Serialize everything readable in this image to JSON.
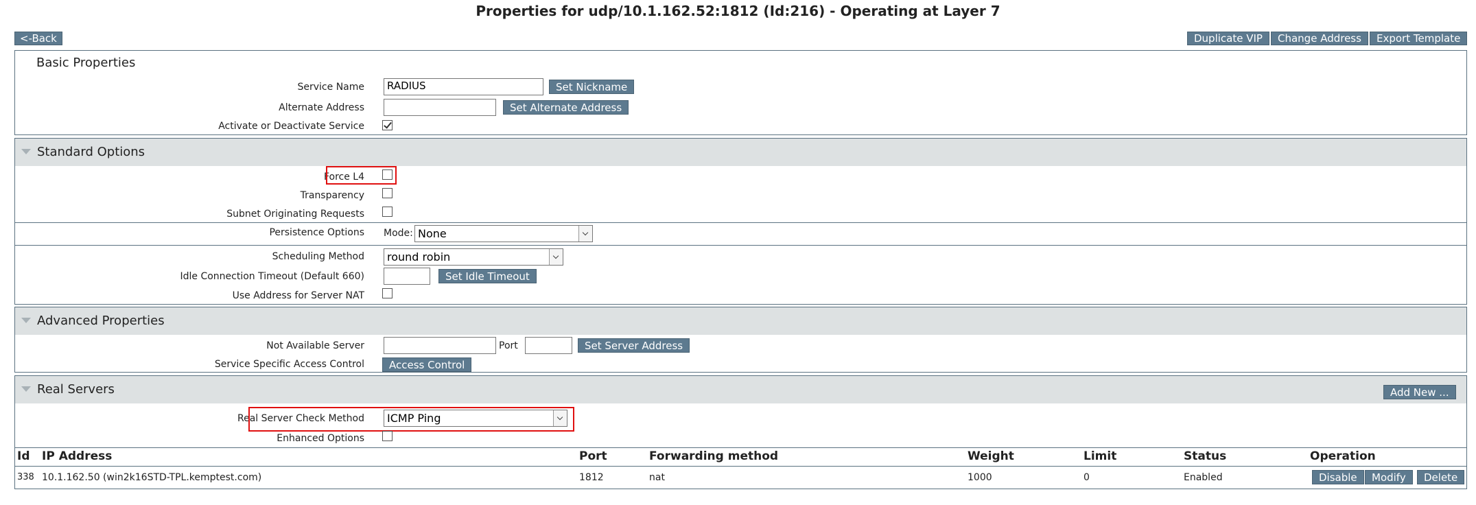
{
  "page": {
    "title": "Properties for udp/10.1.162.52:1812 (Id:216) - Operating at Layer 7"
  },
  "toolbar": {
    "back_label": "<-Back",
    "duplicate_label": "Duplicate VIP",
    "change_address_label": "Change Address",
    "export_label": "Export Template"
  },
  "basic": {
    "heading": "Basic Properties",
    "service_name_label": "Service Name",
    "service_name_value": "RADIUS",
    "set_nickname_label": "Set Nickname",
    "alt_address_label": "Alternate Address",
    "alt_address_value": "",
    "set_alt_address_label": "Set Alternate Address",
    "activate_label": "Activate or Deactivate Service"
  },
  "standard": {
    "heading": "Standard Options",
    "force_l4_label": "Force L4",
    "transparency_label": "Transparency",
    "subnet_label": "Subnet Originating Requests",
    "persistence_label": "Persistence Options",
    "mode_label": "Mode:",
    "mode_value": "None",
    "scheduling_label": "Scheduling Method",
    "scheduling_value": "round robin",
    "idle_label": "Idle Connection Timeout (Default 660)",
    "idle_value": "",
    "set_idle_label": "Set Idle Timeout",
    "server_nat_label": "Use Address for Server NAT"
  },
  "advanced": {
    "heading": "Advanced Properties",
    "not_available_label": "Not Available Server",
    "not_available_value": "",
    "port_label": "Port",
    "port_value": "",
    "set_server_address_label": "Set Server Address",
    "access_control_row_label": "Service Specific Access Control",
    "access_control_button_label": "Access Control"
  },
  "real_servers": {
    "heading": "Real Servers",
    "add_new_label": "Add New ...",
    "check_method_label": "Real Server Check Method",
    "check_method_value": "ICMP Ping",
    "enhanced_label": "Enhanced Options",
    "columns": {
      "id": "Id",
      "ip": "IP Address",
      "port": "Port",
      "forwarding": "Forwarding method",
      "weight": "Weight",
      "limit": "Limit",
      "status": "Status",
      "operation": "Operation"
    },
    "rows": [
      {
        "id": "338",
        "ip": "10.1.162.50 (win2k16STD-TPL.kemptest.com)",
        "port": "1812",
        "forwarding": "nat",
        "weight": "1000",
        "limit": "0",
        "status": "Enabled",
        "disable_label": "Disable",
        "modify_label": "Modify",
        "delete_label": "Delete"
      }
    ]
  },
  "colors": {
    "button_bg": "#5d7a8f",
    "section_header_bg": "#dde1e2",
    "highlight": "#e01010"
  },
  "checkboxes": {
    "activate": true,
    "force_l4": false,
    "transparency": false,
    "subnet": false,
    "server_nat": false,
    "enhanced": false
  }
}
